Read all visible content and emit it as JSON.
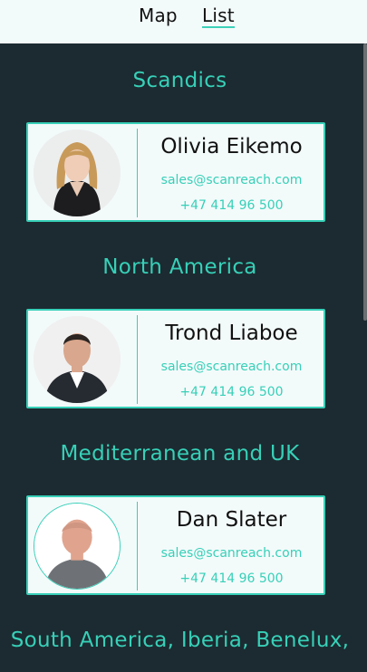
{
  "tabs": {
    "map_label": "Map",
    "list_label": "List",
    "active": "List"
  },
  "colors": {
    "accent": "#37d0b8",
    "background": "#1c2b31",
    "card_background": "#f3fafa"
  },
  "regions": [
    {
      "title": "Scandics",
      "contact": {
        "name": "Olivia Eikemo",
        "email": "sales@scanreach.com",
        "phone": "+47 414 96 500"
      }
    },
    {
      "title": "North America",
      "contact": {
        "name": "Trond Liaboe",
        "email": "sales@scanreach.com",
        "phone": "+47 414 96 500"
      }
    },
    {
      "title": "Mediterranean and UK",
      "contact": {
        "name": "Dan Slater",
        "email": "sales@scanreach.com",
        "phone": "+47 414 96 500"
      }
    },
    {
      "title": "South America, Iberia, Benelux,"
    }
  ]
}
